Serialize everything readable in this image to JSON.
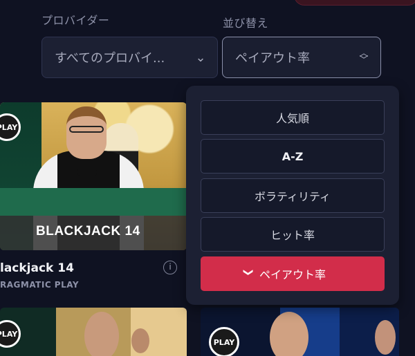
{
  "filters": {
    "provider_label": "プロバイダー",
    "provider_value": "すべてのプロバイ...",
    "sort_label": "並び替え",
    "sort_value": "ペイアウト率"
  },
  "sort_options": [
    {
      "label": "人気順"
    },
    {
      "label": "A-Z"
    },
    {
      "label": "ボラティリティ"
    },
    {
      "label": "ヒット率"
    },
    {
      "label": "ペイアウト率",
      "selected": true
    }
  ],
  "games": [
    {
      "title": "lackjack 14",
      "provider": "RAGMATIC PLAY",
      "image_text": "BLACKJACK 14",
      "badge": "PLAY"
    }
  ],
  "bottom_badges": [
    "PLAY",
    "PLAY"
  ],
  "colors": {
    "accent": "#d22d4a",
    "background": "#0f1222",
    "panel": "#1c2033"
  }
}
